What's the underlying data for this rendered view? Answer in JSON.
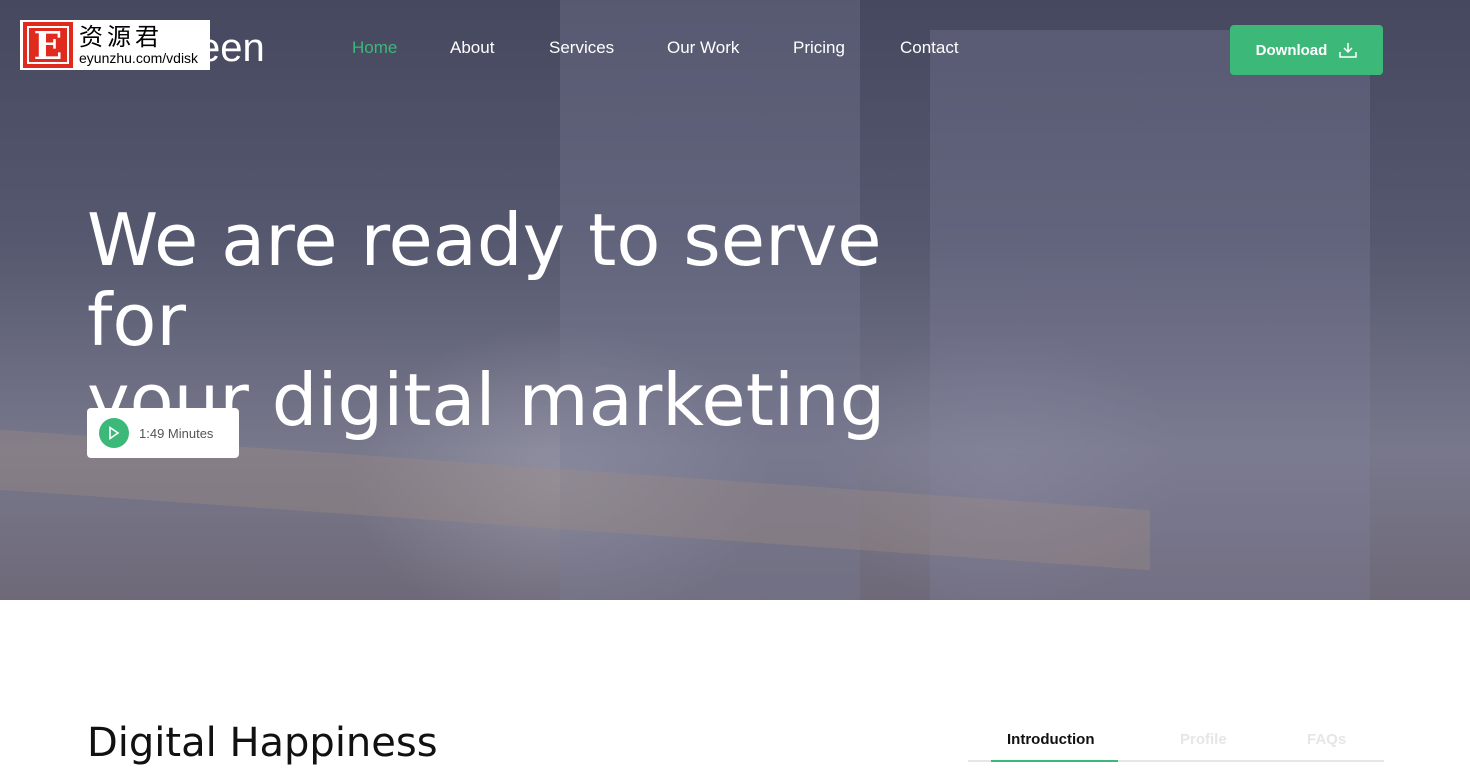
{
  "watermark": {
    "brand_letter": "E",
    "name": "资源君",
    "url": "eyunzhu.com/vdisk"
  },
  "header": {
    "logo_visible": "een",
    "nav": [
      {
        "label": "Home",
        "active": true
      },
      {
        "label": "About"
      },
      {
        "label": "Services"
      },
      {
        "label": "Our Work"
      },
      {
        "label": "Pricing"
      },
      {
        "label": "Contact"
      }
    ],
    "download_label": "Download",
    "download_icon": "download-icon"
  },
  "hero": {
    "title_line1": "We are ready to serve for",
    "title_line2": "your digital marketing",
    "video_duration": "1:49 Minutes",
    "play_icon": "play-icon"
  },
  "section": {
    "title": "Digital Happiness",
    "tabs": [
      {
        "label": "Introduction",
        "active": true
      },
      {
        "label": "Profile"
      },
      {
        "label": "FAQs"
      }
    ]
  },
  "colors": {
    "accent": "#3cb878",
    "text": "#111111"
  }
}
